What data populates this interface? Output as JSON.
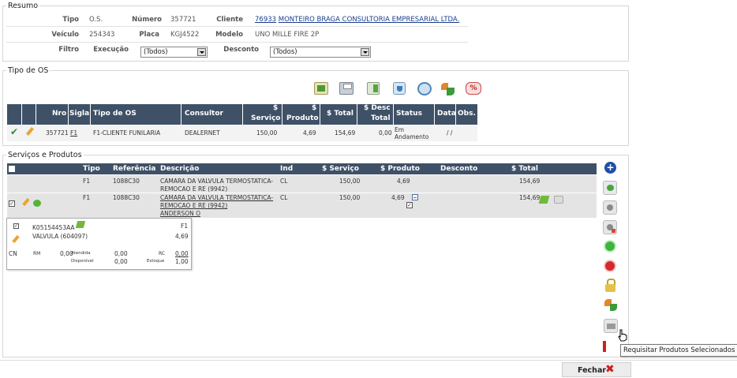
{
  "resumo": {
    "legend": "Resumo",
    "tipo_label": "Tipo",
    "tipo_value": "O.S.",
    "numero_label": "Número",
    "numero_value": "357721",
    "cliente_label": "Cliente",
    "cliente_code": "76933",
    "cliente_name": "MONTEIRO BRAGA CONSULTORIA EMPRESARIAL LTDA.",
    "veiculo_label": "Veículo",
    "veiculo_value": "254343",
    "placa_label": "Placa",
    "placa_value": "KGJ4522",
    "modelo_label": "Modelo",
    "modelo_value": "UNO MILLE FIRE 2P",
    "filtro_label": "Filtro",
    "execucao_label": "Execução",
    "execucao_value": "(Todos)",
    "desconto_label": "Desconto",
    "desconto_value": "(Todos)"
  },
  "tipo_os": {
    "legend": "Tipo de OS",
    "icons": [
      "report-icon",
      "print-icon",
      "document-icon",
      "cup-icon",
      "refresh-icon",
      "recycle-icon",
      "discount-icon"
    ],
    "headers": {
      "nro": "Nro",
      "sigla": "Sigla",
      "tipo": "Tipo de OS",
      "consultor": "Consultor",
      "servico_top": "$",
      "servico_bottom": "Serviço",
      "produto_top": "$",
      "produto_bottom": "Produto",
      "total": "$ Total",
      "desc_top": "$ Desc",
      "desc_bottom": "Total",
      "status": "Status",
      "data": "Data",
      "obs": "Obs."
    },
    "row": {
      "nro": "357721",
      "sigla": "F1",
      "tipo": "F1-CLIENTE FUNILARIA",
      "consultor": "DEALERNET",
      "servico": "150,00",
      "produto": "4,69",
      "total": "154,69",
      "desc": "0,00",
      "status_top": "Em",
      "status_bottom": "Andamento",
      "data": "/ /"
    }
  },
  "servicos": {
    "legend": "Serviços e Produtos",
    "headers": {
      "tipo": "Tipo",
      "referencia": "Referência",
      "descricao": "Descrição",
      "ind": "Ind",
      "servico": "$ Serviço",
      "produto": "$ Produto",
      "desconto": "Desconto",
      "total": "$ Total"
    },
    "rows": [
      {
        "tipo": "F1",
        "referencia": "1088C30",
        "desc1": "CAMARA DA VALVULA TERMOSTATICA-",
        "desc2": "REMOCAO E RE (9942)",
        "desc3": "",
        "ind": "CL",
        "servico": "150,00",
        "produto": "4,69",
        "total": "154,69"
      },
      {
        "tipo": "F1",
        "referencia": "1088C30",
        "desc1": "CAMARA DA VALVULA TERMOSTATICA-",
        "desc2": "REMOCAO E RE (9942)",
        "desc3": "ANDERSON O",
        "ind": "CL",
        "servico": "150,00",
        "produto": "4,69",
        "total": "154,69"
      }
    ],
    "detail": {
      "code": "K05154453AA",
      "tipo": "F1",
      "name": "VALVULA (604097)",
      "price": "4,69",
      "cn": "CN",
      "rm_label": "RM",
      "rm_value": "0,00",
      "atendida_label": "Atendida",
      "atendida_value": "0,00",
      "rc_label": "RC",
      "rc_value": "0,00",
      "disponivel_label": "Disponível",
      "disponivel_value": "0,00",
      "estoque_label": "Estoque",
      "estoque_value": "1,00"
    }
  },
  "tooltip": "Requisitar Produtos Selecionados",
  "fechar_label": "Fechar",
  "colors": {
    "header_bg": "#3f5167",
    "link": "#1a3e8c",
    "border": "#d6d6d6"
  }
}
